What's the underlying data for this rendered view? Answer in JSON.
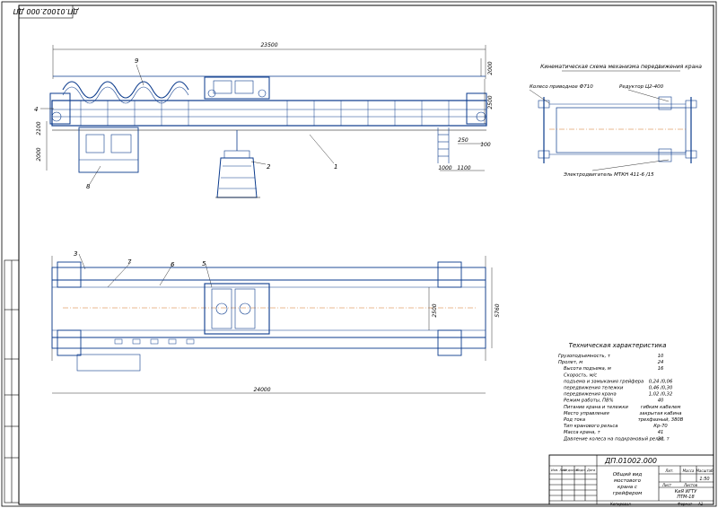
{
  "stamp_rotated": "ДП.01002.000 ДП",
  "dim": {
    "span_top": "23500",
    "right_h1": "2000",
    "right_h2": "2500",
    "left_h1": "2100",
    "left_h2": "2000",
    "step1": "250",
    "step2": "100",
    "bottom1": "1000",
    "bottom2": "1100",
    "plan_w": "24000",
    "plan_gap": "2500",
    "plan_h": "5760"
  },
  "callouts": [
    "1",
    "2",
    "3",
    "4",
    "5",
    "6",
    "7",
    "8",
    "9"
  ],
  "kinematic": {
    "title": "Кинематическая схема механизма передвижения крана",
    "wheel": "Колесо приводное Ф710",
    "reducer": "Редуктор Ц2-400",
    "motor": "Электродвигатель МТКН 411-6 /15"
  },
  "tech": {
    "title": "Техническая характеристика",
    "rows": [
      {
        "label": "Грузоподъемность, т",
        "value": "10"
      },
      {
        "label": "Пролет, м",
        "value": "24"
      },
      {
        "label": "Высота подъема, м",
        "value": "16"
      },
      {
        "label": "Скорость, м/с",
        "value": ""
      },
      {
        "label": "подъема и замыкания грейфера",
        "value": "0,24 /0,06"
      },
      {
        "label": "передвижения тележки",
        "value": "0,46 /0,30"
      },
      {
        "label": "передвижения крана",
        "value": "1,02 /0,32"
      },
      {
        "label": "Режим работы, ПВ%",
        "value": "40"
      },
      {
        "label": "Питание крана и тележки",
        "value": "гибким кабелем"
      },
      {
        "label": "Место управления",
        "value": "закрытая кабина"
      },
      {
        "label": "Род тока",
        "value": "трехфазный, 380В"
      },
      {
        "label": "Тип кранового рельса",
        "value": "Кр-70"
      },
      {
        "label": "Масса крана, т",
        "value": "41"
      },
      {
        "label": "Давление колеса на подкрановый рельс, т",
        "value": "20"
      }
    ]
  },
  "title_block": {
    "code": "ДП.01002.000",
    "name": "Общий вид мостового крана с грейфером",
    "scale": "1:50",
    "org": "КиЯ ИГТУ ПТМ-18",
    "hdr_lit": "Лит.",
    "hdr_mass": "Масса",
    "hdr_scale": "Масштаб",
    "sheet": "Лист",
    "sheets": "Листов",
    "copied": "Копировал",
    "format": "Формат",
    "format_val": "А1",
    "rows": [
      "Изм. Лист",
      "№ докум.",
      "Подп.",
      "Дата"
    ]
  }
}
